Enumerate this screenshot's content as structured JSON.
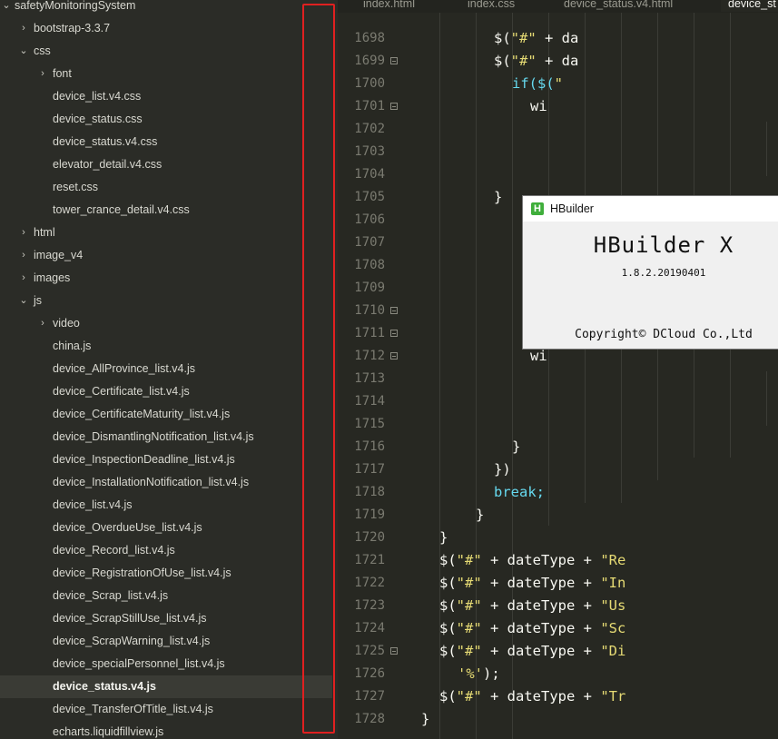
{
  "sidebar": {
    "root": "safetyMonitoringSystem",
    "items": [
      {
        "label": "bootstrap-3.3.7",
        "type": "folder",
        "expanded": false
      },
      {
        "label": "css",
        "type": "folder",
        "expanded": true
      },
      {
        "label": "font",
        "type": "folder",
        "expanded": false
      },
      {
        "label": "device_list.v4.css",
        "type": "file"
      },
      {
        "label": "device_status.css",
        "type": "file"
      },
      {
        "label": "device_status.v4.css",
        "type": "file"
      },
      {
        "label": "elevator_detail.v4.css",
        "type": "file"
      },
      {
        "label": "reset.css",
        "type": "file"
      },
      {
        "label": "tower_crance_detail.v4.css",
        "type": "file"
      },
      {
        "label": "html",
        "type": "folder",
        "expanded": false
      },
      {
        "label": "image_v4",
        "type": "folder",
        "expanded": false
      },
      {
        "label": "images",
        "type": "folder",
        "expanded": false
      },
      {
        "label": "js",
        "type": "folder",
        "expanded": true
      },
      {
        "label": "video",
        "type": "folder",
        "expanded": false
      },
      {
        "label": "china.js",
        "type": "file"
      },
      {
        "label": "device_AllProvince_list.v4.js",
        "type": "file"
      },
      {
        "label": "device_Certificate_list.v4.js",
        "type": "file"
      },
      {
        "label": "device_CertificateMaturity_list.v4.js",
        "type": "file"
      },
      {
        "label": "device_DismantlingNotification_list.v4.js",
        "type": "file"
      },
      {
        "label": "device_InspectionDeadline_list.v4.js",
        "type": "file"
      },
      {
        "label": "device_InstallationNotification_list.v4.js",
        "type": "file"
      },
      {
        "label": "device_list.v4.js",
        "type": "file"
      },
      {
        "label": "device_OverdueUse_list.v4.js",
        "type": "file"
      },
      {
        "label": "device_Record_list.v4.js",
        "type": "file"
      },
      {
        "label": "device_RegistrationOfUse_list.v4.js",
        "type": "file"
      },
      {
        "label": "device_Scrap_list.v4.js",
        "type": "file"
      },
      {
        "label": "device_ScrapStillUse_list.v4.js",
        "type": "file"
      },
      {
        "label": "device_ScrapWarning_list.v4.js",
        "type": "file"
      },
      {
        "label": "device_specialPersonnel_list.v4.js",
        "type": "file"
      },
      {
        "label": "device_status.v4.js",
        "type": "file",
        "selected": true
      },
      {
        "label": "device_TransferOfTitle_list.v4.js",
        "type": "file"
      },
      {
        "label": "echarts.liquidfillview.js",
        "type": "file"
      }
    ]
  },
  "tabs": [
    {
      "label": "index.html"
    },
    {
      "label": "index.css"
    },
    {
      "label": "device_status.v4.html"
    },
    {
      "label": "device_st",
      "active": true
    }
  ],
  "editor": {
    "line_numbers": [
      "1698",
      "1699",
      "1700",
      "1701",
      "1702",
      "1703",
      "1704",
      "1705",
      "1706",
      "1707",
      "1708",
      "1709",
      "1710",
      "1711",
      "1712",
      "1713",
      "1714",
      "1715",
      "1716",
      "1717",
      "1718",
      "1719",
      "1720",
      "1721",
      "1722",
      "1723",
      "1724",
      "1725",
      "1726",
      "1727",
      "1728"
    ],
    "code_lines": [
      "$(\"#\" + da",
      "$(\"#\" + da",
      "if($(\"",
      "wi",
      "",
      "",
      "",
      "}",
      "",
      "",
      "",
      "",
      "",
      "",
      "wi",
      "",
      "",
      "",
      "}",
      "})",
      "break;",
      "}",
      "}",
      "$(\"#\" + dateType + \"Re",
      "$(\"#\" + dateType + \"In",
      "$(\"#\" + dateType + \"Us",
      "$(\"#\" + dateType + \"Sc",
      "$(\"#\" + dateType + \"Di",
      "'%');",
      "$(\"#\" + dateType + \"Tr",
      "}"
    ]
  },
  "about_dialog": {
    "title": "HBuilder",
    "logo_letter": "H",
    "product": "HBuilder X",
    "version": "1.8.2.20190401",
    "copyright": "Copyright© DCloud Co.,Ltd"
  },
  "colors": {
    "sidebar_bg": "#2b2c27",
    "editor_bg": "#272822",
    "highlight_box": "#e02020",
    "keyword": "#66d9ef",
    "string": "#e6db74",
    "logo_green": "#3fae3b"
  }
}
